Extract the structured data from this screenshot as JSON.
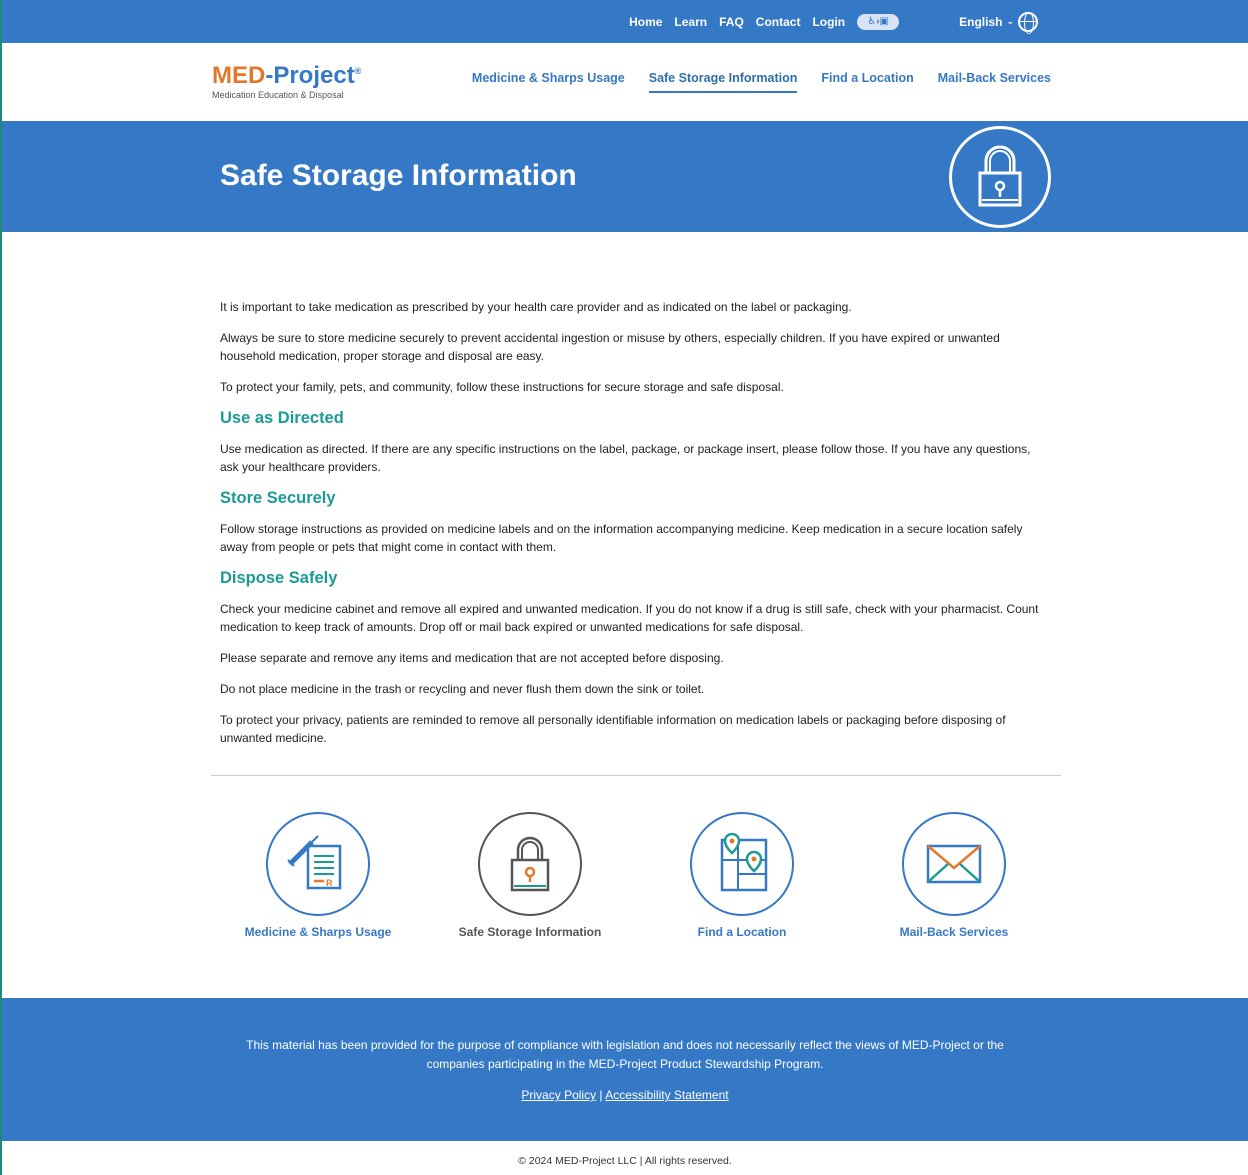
{
  "topnav": {
    "items": [
      "Home",
      "Learn",
      "FAQ",
      "Contact",
      "Login"
    ],
    "language": "English"
  },
  "logo": {
    "part1": "MED",
    "part2": "-Project",
    "mark": "®",
    "subtitle": "Medication Education & Disposal"
  },
  "mainnav": {
    "items": [
      "Medicine & Sharps Usage",
      "Safe Storage Information",
      "Find a Location",
      "Mail-Back Services"
    ],
    "active": "Safe Storage Information"
  },
  "hero": {
    "title": "Safe Storage Information"
  },
  "content": {
    "intro": [
      "It is important to take medication as prescribed by your health care provider and as indicated on the label or packaging.",
      "Always be sure to store medicine securely to prevent accidental ingestion or misuse by others, especially children. If you have expired or unwanted household medication, proper storage and disposal are easy.",
      "To protect your family, pets, and community, follow these instructions for secure storage and safe disposal."
    ],
    "sections": [
      {
        "heading": "Use as Directed",
        "paragraphs": [
          "Use medication as directed. If there are any specific instructions on the label, package, or package insert, please follow those. If you have any questions, ask your healthcare providers."
        ]
      },
      {
        "heading": "Store Securely",
        "paragraphs": [
          "Follow storage instructions as provided on medicine labels and on the information accompanying medicine. Keep medication in a secure location safely away from people or pets that might come in contact with them."
        ]
      },
      {
        "heading": "Dispose Safely",
        "paragraphs": [
          "Check your medicine cabinet and remove all expired and unwanted medication. If you do not know if a drug is still safe, check with your pharmacist. Count medication to keep track of amounts. Drop off or mail back expired or unwanted medications for safe disposal.",
          "Please separate and remove any items and medication that are not accepted before disposing.",
          "Do not place medicine in the trash or recycling and never flush them down the sink or toilet.",
          "To protect your privacy, patients are reminded to remove all personally identifiable information on medication labels or packaging before disposing of unwanted medicine."
        ]
      }
    ]
  },
  "tiles": [
    {
      "label": "Medicine & Sharps Usage",
      "icon": "syringe-prescription-icon"
    },
    {
      "label": "Safe Storage Information",
      "icon": "padlock-icon"
    },
    {
      "label": "Find a Location",
      "icon": "map-pin-icon"
    },
    {
      "label": "Mail-Back Services",
      "icon": "envelope-icon"
    }
  ],
  "footer": {
    "message": "This material has been provided for the purpose of compliance with legislation and does not necessarily reflect the views of MED-Project or the companies participating in the MED-Project Product Stewardship Program.",
    "privacy": "Privacy Policy",
    "separator": "|",
    "accessibility": "Accessibility Statement",
    "copyright": "© 2024 MED-Project LLC | All rights reserved."
  },
  "colors": {
    "brand_blue": "#3578c6",
    "teal": "#1b9a97",
    "orange": "#e07a2a"
  }
}
